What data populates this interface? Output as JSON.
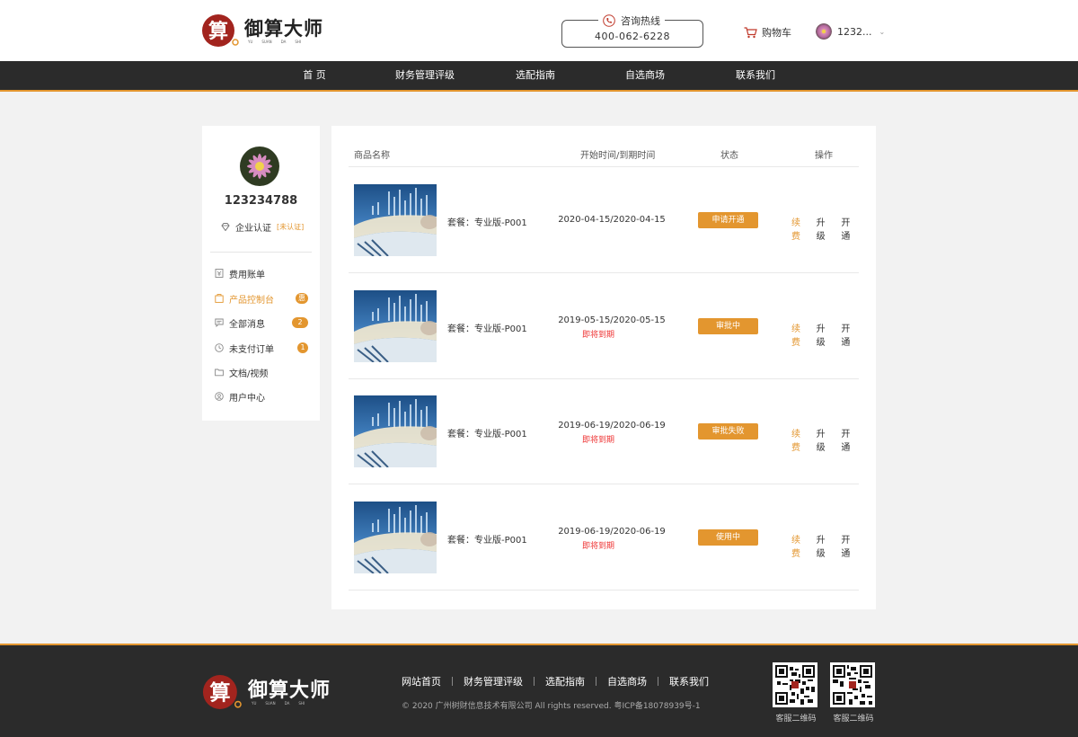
{
  "brand": {
    "name": "御算大师",
    "pinyin": [
      "YU",
      "SUAN",
      "DA",
      "SHI"
    ],
    "seal_char": "算",
    "accent_color": "#e3962f"
  },
  "header": {
    "hotline_label": "咨询热线",
    "hotline_number": "400-062-6228",
    "cart_label": "购物车",
    "user_name": "1232..."
  },
  "nav": {
    "items": [
      "首 页",
      "财务管理评级",
      "选配指南",
      "自选商场",
      "联系我们"
    ]
  },
  "sidebar": {
    "user_id": "123234788",
    "cert_label": "企业认证",
    "cert_status": "[未认证]",
    "items": [
      {
        "label": "费用账单",
        "icon": "bill-icon",
        "badge": ""
      },
      {
        "label": "产品控制台",
        "icon": "console-icon",
        "badge": "惠"
      },
      {
        "label": "全部消息",
        "icon": "message-icon",
        "badge": "2"
      },
      {
        "label": "未支付订单",
        "icon": "clock-icon",
        "badge": "1"
      },
      {
        "label": "文档/视频",
        "icon": "folder-icon",
        "badge": ""
      },
      {
        "label": "用户中心",
        "icon": "user-icon",
        "badge": ""
      }
    ]
  },
  "table": {
    "headers": [
      "商品名称",
      "开始时间/到期时间",
      "状态",
      "操作"
    ],
    "rows": [
      {
        "name": "套餐：专业版-P001",
        "dates": "2020-04-15/2020-04-15",
        "expire": "",
        "status": "申请开通",
        "ops": [
          "续费",
          "升级",
          "开通"
        ]
      },
      {
        "name": "套餐：专业版-P001",
        "dates": "2019-05-15/2020-05-15",
        "expire": "即将到期",
        "status": "审批中",
        "ops": [
          "续费",
          "升级",
          "开通"
        ]
      },
      {
        "name": "套餐：专业版-P001",
        "dates": "2019-06-19/2020-06-19",
        "expire": "即将到期",
        "status": "审批失败",
        "ops": [
          "续费",
          "升级",
          "开通"
        ]
      },
      {
        "name": "套餐：专业版-P001",
        "dates": "2019-06-19/2020-06-19",
        "expire": "即将到期",
        "status": "使用中",
        "ops": [
          "续费",
          "升级",
          "开通"
        ]
      }
    ]
  },
  "footer": {
    "links": [
      "网站首页",
      "财务管理评级",
      "选配指南",
      "自选商场",
      "联系我们"
    ],
    "copyright": "© 2020 广州树财信息技术有限公司    All rights reserved.    粤ICP备18078939号-1",
    "qr_labels": [
      "客服二维码",
      "客服二维码"
    ]
  }
}
